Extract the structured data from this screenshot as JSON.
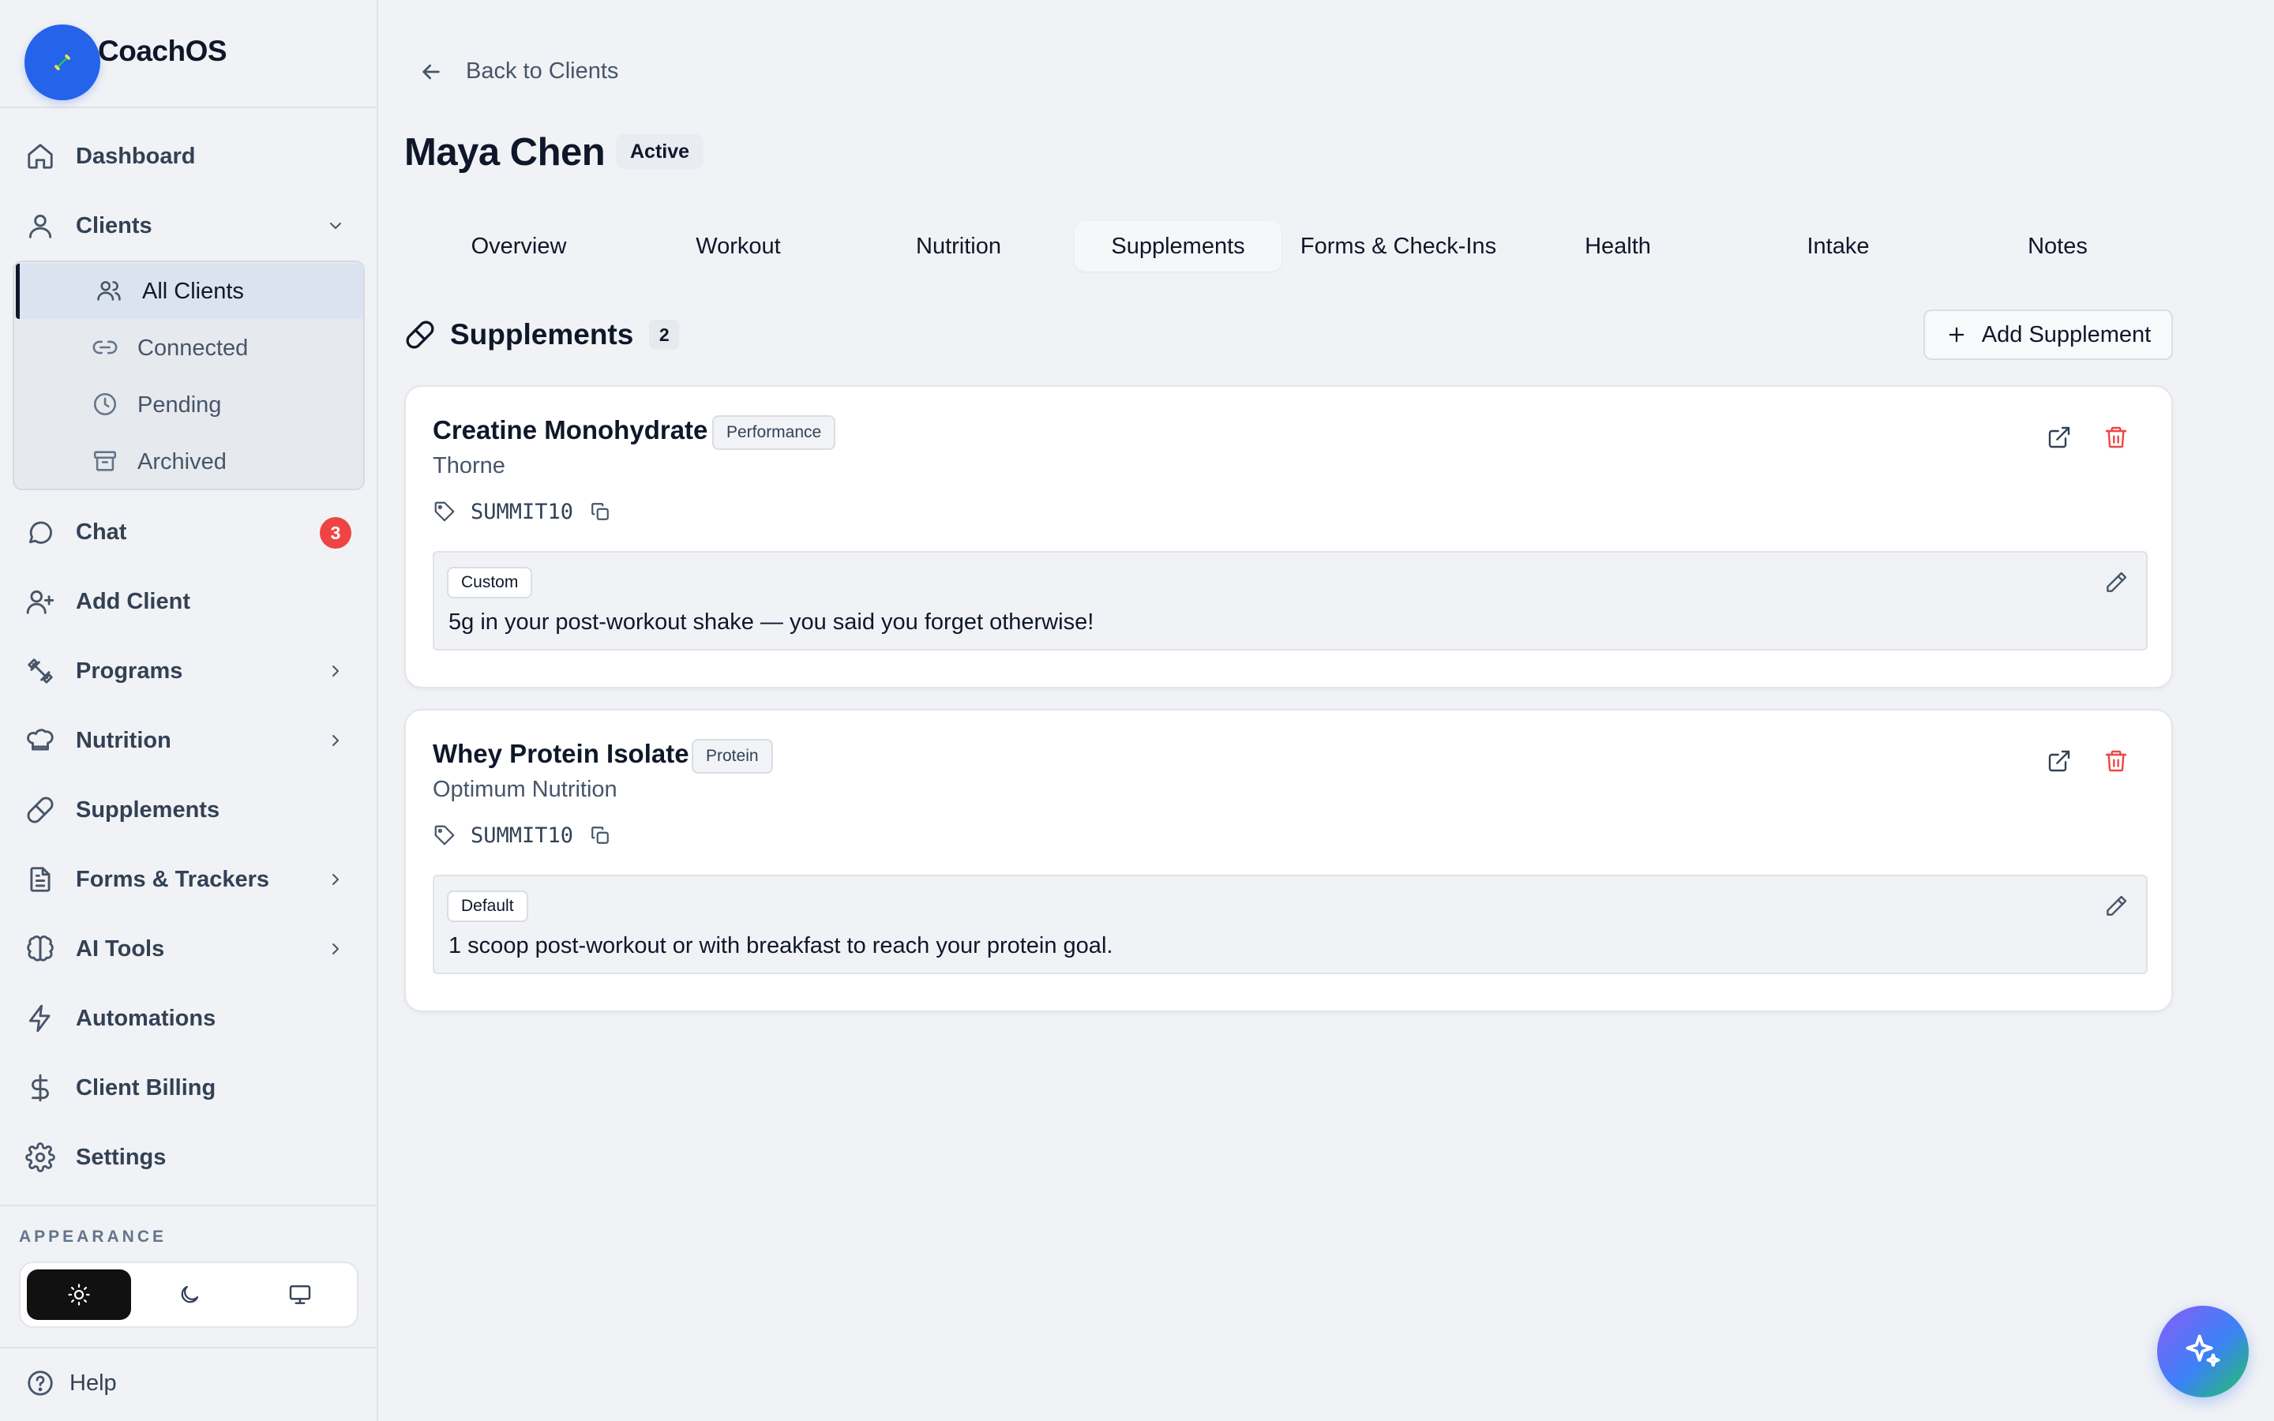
{
  "brand": {
    "name": "CoachOS"
  },
  "sidebar": {
    "items": [
      {
        "label": "Dashboard",
        "icon": "home-icon"
      },
      {
        "label": "Clients",
        "icon": "user-icon",
        "expanded": true
      },
      {
        "label": "Chat",
        "icon": "chat-icon",
        "badge": "3"
      },
      {
        "label": "Add Client",
        "icon": "user-plus-icon"
      },
      {
        "label": "Programs",
        "icon": "dumbbell-icon"
      },
      {
        "label": "Nutrition",
        "icon": "chef-hat-icon"
      },
      {
        "label": "Supplements",
        "icon": "pill-icon"
      },
      {
        "label": "Forms & Trackers",
        "icon": "document-icon"
      },
      {
        "label": "AI Tools",
        "icon": "brain-icon"
      },
      {
        "label": "Automations",
        "icon": "lightning-icon"
      },
      {
        "label": "Client Billing",
        "icon": "dollar-icon"
      },
      {
        "label": "Settings",
        "icon": "gear-icon"
      }
    ],
    "client_subitems": [
      {
        "label": "All Clients",
        "icon": "users-icon",
        "active": true
      },
      {
        "label": "Connected",
        "icon": "link-icon"
      },
      {
        "label": "Pending",
        "icon": "clock-icon"
      },
      {
        "label": "Archived",
        "icon": "archive-icon"
      }
    ],
    "appearance_label": "APPEARANCE",
    "theme_options": [
      "light",
      "dark",
      "system"
    ],
    "theme_selected": "light",
    "help_label": "Help"
  },
  "main": {
    "back_label": "Back to Clients",
    "client_name": "Maya Chen",
    "client_status": "Active",
    "tabs": [
      {
        "label": "Overview"
      },
      {
        "label": "Workout"
      },
      {
        "label": "Nutrition"
      },
      {
        "label": "Supplements",
        "active": true
      },
      {
        "label": "Forms & Check-Ins"
      },
      {
        "label": "Health"
      },
      {
        "label": "Intake"
      },
      {
        "label": "Notes"
      }
    ],
    "section_title": "Supplements",
    "section_count": "2",
    "add_button_label": "Add Supplement",
    "supplements": [
      {
        "name": "Creatine Monohydrate",
        "category": "Performance",
        "brand": "Thorne",
        "code": "SUMMIT10",
        "note_type": "Custom",
        "note": "5g in your post-workout shake — you said you forget otherwise!"
      },
      {
        "name": "Whey Protein Isolate",
        "category": "Protein",
        "brand": "Optimum Nutrition",
        "code": "SUMMIT10",
        "note_type": "Default",
        "note": "1 scoop post-workout or with breakfast to reach your protein goal."
      }
    ]
  },
  "colors": {
    "accent": "#2563eb",
    "danger": "#ef4444",
    "background": "#f1f2f5"
  }
}
